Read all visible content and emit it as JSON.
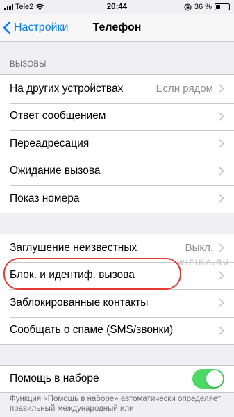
{
  "status_bar": {
    "carrier": "Tele2",
    "time": "20:44",
    "battery_percent_text": "36 %",
    "battery_level": 0.36
  },
  "nav": {
    "back_label": "Настройки",
    "title": "Телефон"
  },
  "sections": {
    "calls_header": "ВЫЗОВЫ",
    "calls_rows": [
      {
        "label": "На других устройствах",
        "value": "Если рядом"
      },
      {
        "label": "Ответ сообщением",
        "value": ""
      },
      {
        "label": "Переадресация",
        "value": ""
      },
      {
        "label": "Ожидание вызова",
        "value": ""
      },
      {
        "label": "Показ номера",
        "value": ""
      }
    ],
    "blocking_rows": [
      {
        "label": "Заглушение неизвестных",
        "value": "Выкл."
      },
      {
        "label": "Блок. и идентиф. вызова",
        "value": ""
      },
      {
        "label": "Заблокированные контакты",
        "value": ""
      },
      {
        "label": "Сообщать о спаме (SMS/звонки)",
        "value": ""
      }
    ],
    "dial_assist": {
      "label": "Помощь в наборе",
      "enabled": true
    },
    "footer": "Функция «Помощь в наборе» автоматически определяет правильный международный или"
  },
  "watermark": "WIFIKA.RU",
  "colors": {
    "accent": "#007aff",
    "toggle_on": "#4cd964",
    "highlight": "#e53935"
  }
}
